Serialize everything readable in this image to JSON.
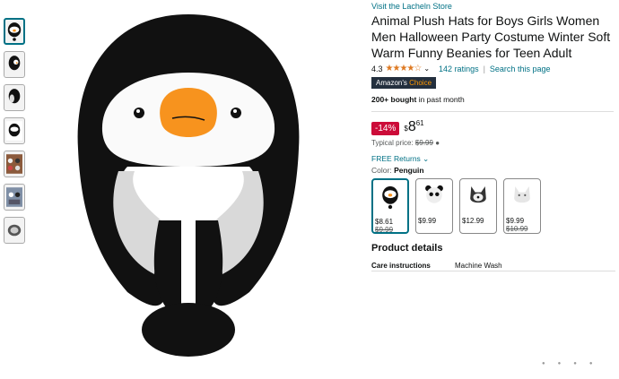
{
  "store_link": "Visit the Lacheln Store",
  "title": "Animal Plush Hats for Boys Girls Women Men Halloween Party Costume Winter Soft Warm Funny Beanies for Teen Adult",
  "rating": {
    "value": "4.3",
    "stars": "★★★★☆",
    "count_text": "142 ratings",
    "search_text": "Search this page"
  },
  "badge": {
    "amazons": "Amazon's",
    "choice": "Choice"
  },
  "bought": {
    "bold": "200+ bought",
    "rest": "in past month"
  },
  "price": {
    "discount": "-14%",
    "currency": "$",
    "whole": "8",
    "fraction": "61",
    "typical_label": "Typical price:",
    "typical_value": "$9.99"
  },
  "returns": "FREE Returns",
  "color": {
    "label": "Color:",
    "value": "Penguin"
  },
  "swatches": [
    {
      "price": "$8.61",
      "old": "$9.99",
      "icon": "penguin-hat-icon"
    },
    {
      "price": "$9.99",
      "old": "",
      "icon": "panda-hat-icon"
    },
    {
      "price": "$12.99",
      "old": "",
      "icon": "husky-hat-icon"
    },
    {
      "price": "$9.99",
      "old": "$10.99",
      "icon": "white-dog-hat-icon"
    }
  ],
  "product_details": {
    "heading": "Product details",
    "key": "Care instructions",
    "value": "Machine Wash"
  },
  "thumbnails": [
    "penguin-front",
    "penguin-side",
    "penguin-back",
    "penguin-worn",
    "group-photo",
    "group-photo-2",
    "hat-folded"
  ]
}
